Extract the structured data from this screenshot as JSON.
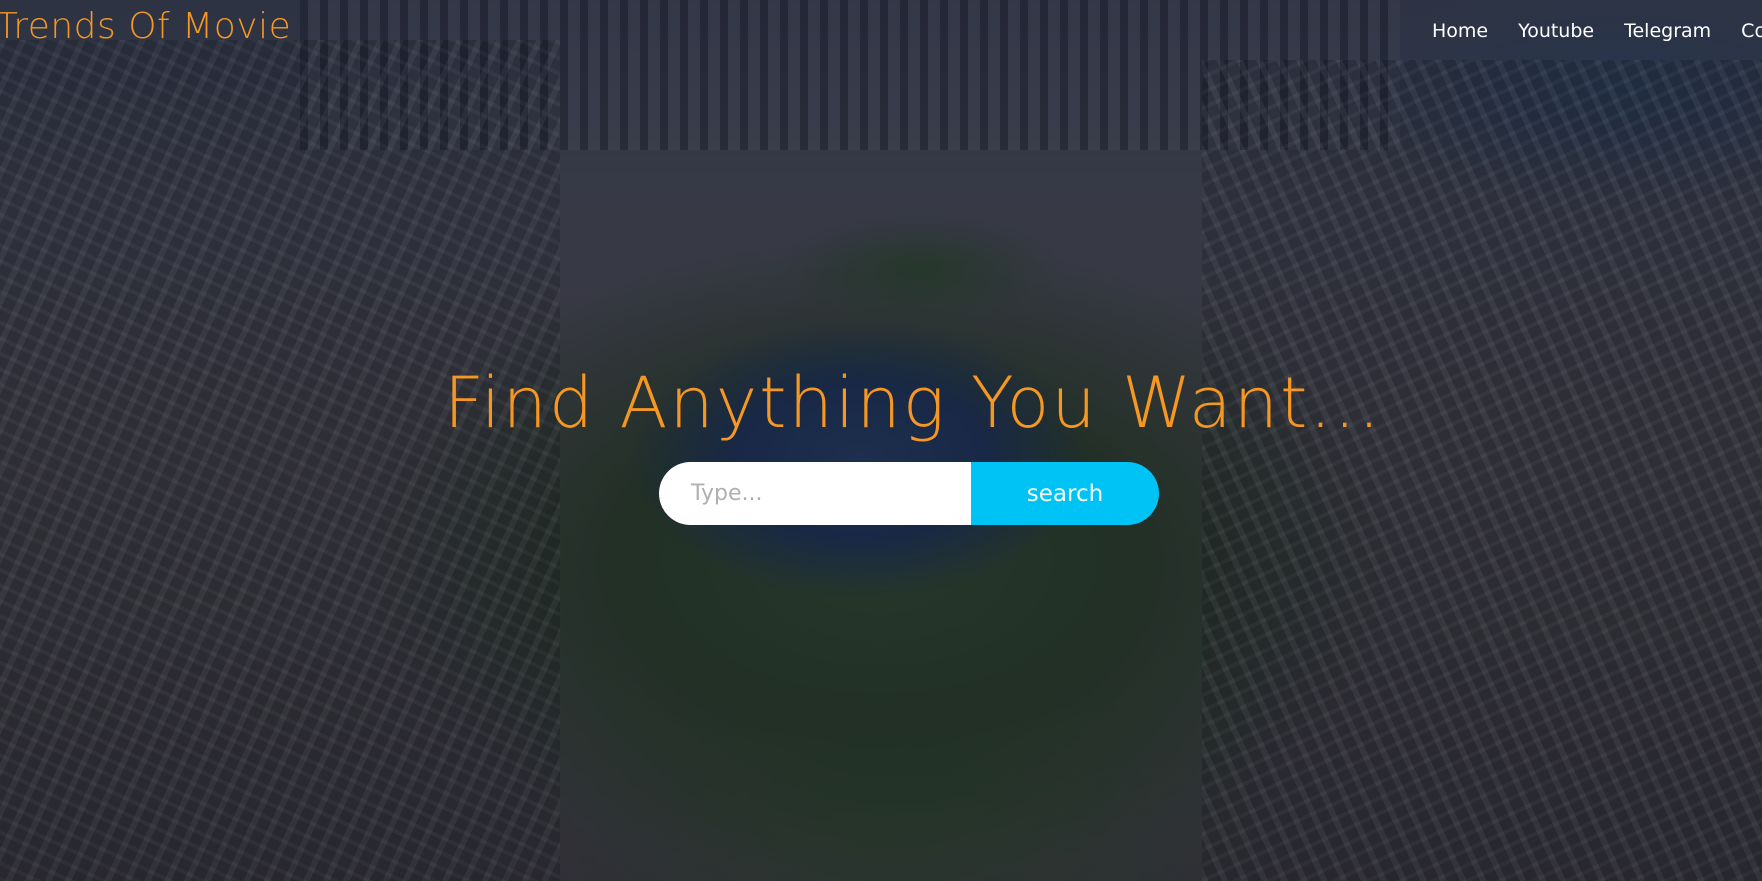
{
  "brand": {
    "name": "Trends Of Movie"
  },
  "nav": {
    "items": [
      {
        "label": "Home"
      },
      {
        "label": "Youtube"
      },
      {
        "label": "Telegram"
      },
      {
        "label": "Co"
      }
    ]
  },
  "hero": {
    "headline": "Find Anything You Want...",
    "search": {
      "placeholder": "Type...",
      "value": "",
      "button_label": "search"
    }
  },
  "colors": {
    "accent": "#f59722",
    "button": "#00c3f5",
    "text_light": "#ffffff"
  }
}
